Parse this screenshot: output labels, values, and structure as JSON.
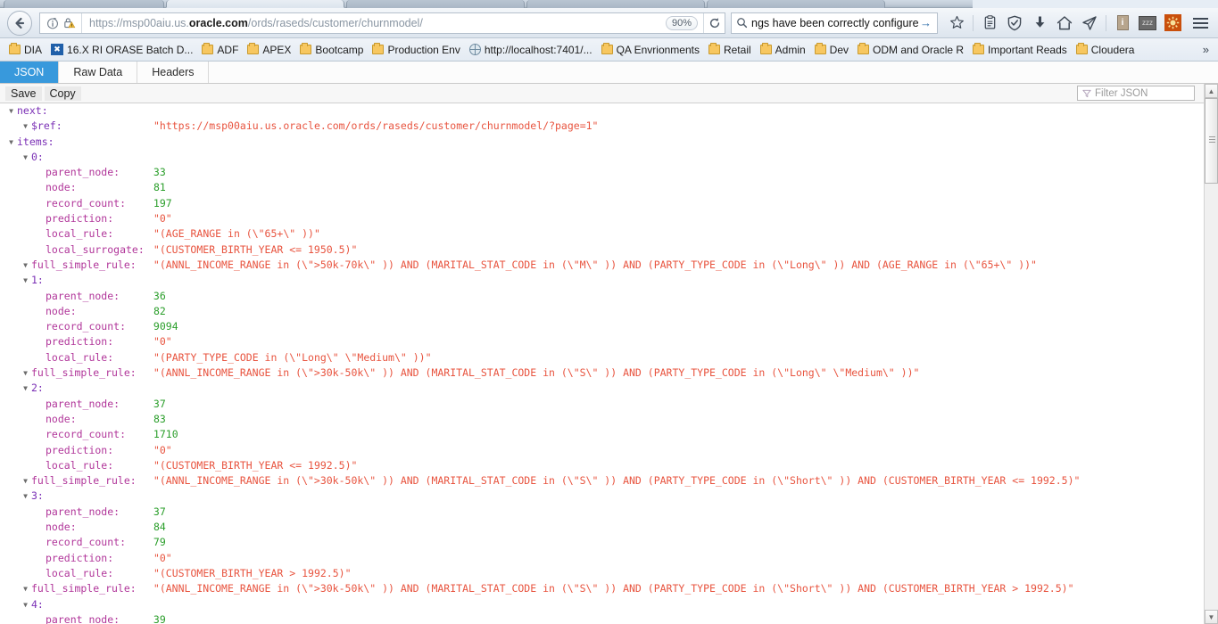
{
  "browser": {
    "url_prefix": "https://msp00aiu.us.",
    "url_domain": "oracle.com",
    "url_suffix": "/ords/raseds/customer/churnmodel/",
    "zoom_level": "90%",
    "search_value": "ngs have been correctly configured",
    "back_icon": "back-arrow-icon",
    "reload_icon": "reload-icon",
    "menu_icon": "hamburger-menu-icon"
  },
  "bookmarks": {
    "items": [
      {
        "label": "DIA",
        "icon": "folder-icon"
      },
      {
        "label": "16.X RI ORASE Batch D...",
        "icon": "blue-app-icon"
      },
      {
        "label": "ADF",
        "icon": "folder-icon"
      },
      {
        "label": "APEX",
        "icon": "folder-icon"
      },
      {
        "label": "Bootcamp",
        "icon": "folder-icon"
      },
      {
        "label": "Production Env",
        "icon": "folder-icon"
      },
      {
        "label": "http://localhost:7401/...",
        "icon": "globe-icon"
      },
      {
        "label": "QA Envrionments",
        "icon": "folder-icon"
      },
      {
        "label": "Retail",
        "icon": "folder-icon"
      },
      {
        "label": "Admin",
        "icon": "folder-icon"
      },
      {
        "label": "Dev",
        "icon": "folder-icon"
      },
      {
        "label": "ODM and Oracle R",
        "icon": "folder-icon"
      },
      {
        "label": "Important Reads",
        "icon": "folder-icon"
      },
      {
        "label": "Cloudera",
        "icon": "folder-icon"
      }
    ],
    "overflow_label": "»"
  },
  "viewer": {
    "tabs": [
      {
        "label": "JSON",
        "active": true
      },
      {
        "label": "Raw Data",
        "active": false
      },
      {
        "label": "Headers",
        "active": false
      }
    ],
    "toolbar": {
      "save_label": "Save",
      "copy_label": "Copy",
      "filter_placeholder": "Filter JSON",
      "filter_icon": "filter-icon"
    },
    "accent_color": "#3899dc"
  },
  "json": {
    "next_label": "next:",
    "ref_key": "$ref:",
    "ref_value": "\"https://msp00aiu.us.oracle.com/ords/raseds/customer/churnmodel/?page=1\"",
    "items_label": "items:",
    "field_labels": {
      "parent_node": "parent_node:",
      "node": "node:",
      "record_count": "record_count:",
      "prediction": "prediction:",
      "local_rule": "local_rule:",
      "local_surrogate": "local_surrogate:",
      "full_simple_rule": "full_simple_rule:"
    },
    "items": [
      {
        "index": "0:",
        "parent_node": "33",
        "node": "81",
        "record_count": "197",
        "prediction": "\"0\"",
        "local_rule": "\"(AGE_RANGE in (\\\"65+\\\" ))\"",
        "local_surrogate": "\"(CUSTOMER_BIRTH_YEAR <= 1950.5)\"",
        "full_simple_rule": "\"(ANNL_INCOME_RANGE in (\\\">50k-70k\\\" )) AND (MARITAL_STAT_CODE in (\\\"M\\\" )) AND (PARTY_TYPE_CODE in (\\\"Long\\\" )) AND (AGE_RANGE in (\\\"65+\\\" ))\""
      },
      {
        "index": "1:",
        "parent_node": "36",
        "node": "82",
        "record_count": "9094",
        "prediction": "\"0\"",
        "local_rule": "\"(PARTY_TYPE_CODE in (\\\"Long\\\" \\\"Medium\\\" ))\"",
        "full_simple_rule": "\"(ANNL_INCOME_RANGE in (\\\">30k-50k\\\" )) AND (MARITAL_STAT_CODE in (\\\"S\\\" )) AND (PARTY_TYPE_CODE in (\\\"Long\\\" \\\"Medium\\\" ))\""
      },
      {
        "index": "2:",
        "parent_node": "37",
        "node": "83",
        "record_count": "1710",
        "prediction": "\"0\"",
        "local_rule": "\"(CUSTOMER_BIRTH_YEAR <= 1992.5)\"",
        "full_simple_rule": "\"(ANNL_INCOME_RANGE in (\\\">30k-50k\\\" )) AND (MARITAL_STAT_CODE in (\\\"S\\\" )) AND (PARTY_TYPE_CODE in (\\\"Short\\\" )) AND (CUSTOMER_BIRTH_YEAR <= 1992.5)\""
      },
      {
        "index": "3:",
        "parent_node": "37",
        "node": "84",
        "record_count": "79",
        "prediction": "\"0\"",
        "local_rule": "\"(CUSTOMER_BIRTH_YEAR > 1992.5)\"",
        "full_simple_rule": "\"(ANNL_INCOME_RANGE in (\\\">30k-50k\\\" )) AND (MARITAL_STAT_CODE in (\\\"S\\\" )) AND (PARTY_TYPE_CODE in (\\\"Short\\\" )) AND (CUSTOMER_BIRTH_YEAR > 1992.5)\""
      },
      {
        "index": "4:",
        "parent_node": "39"
      }
    ]
  }
}
